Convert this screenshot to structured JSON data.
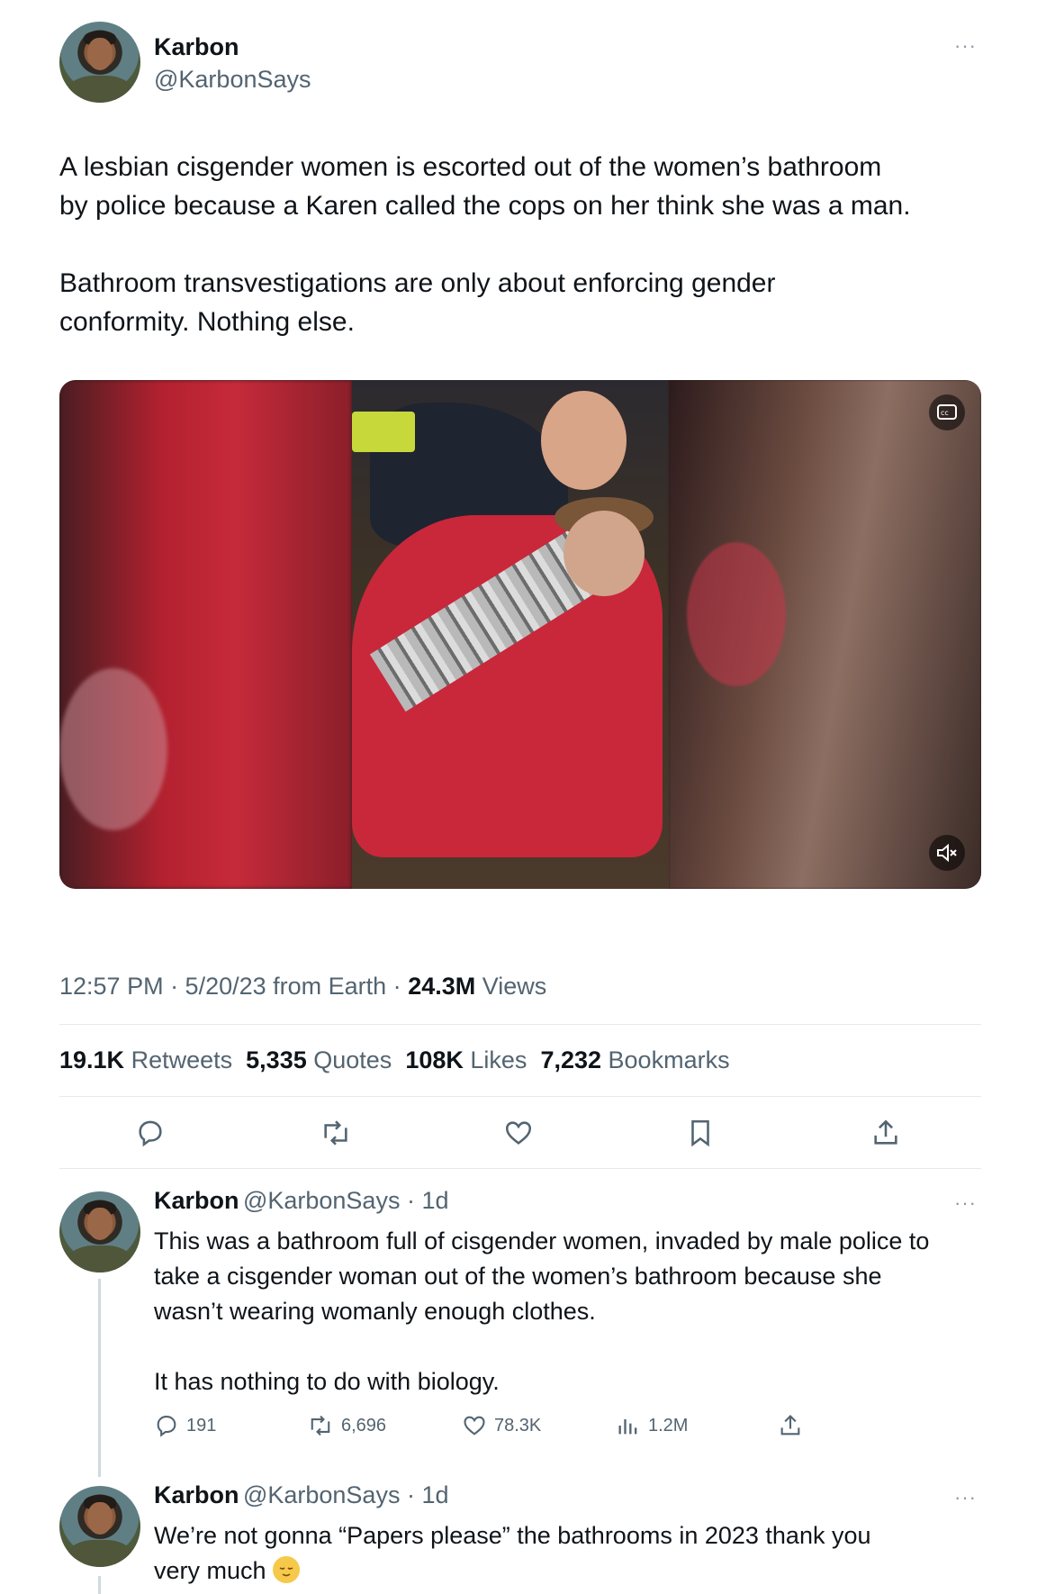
{
  "tweet": {
    "author_name": "Karbon",
    "author_handle": "@KarbonSays",
    "more": "···",
    "text_p1_line1": "A lesbian cisgender women is escorted out of the women’s bathroom",
    "text_p1_line2": "by police because a Karen called the cops on her think she was a man.",
    "text_p2_line1": "Bathroom transvestigations are only about enforcing gender",
    "text_p2_line2": "conformity. Nothing else.",
    "time": "12:57 PM · 5/20/23 from Earth · ",
    "views_count": "24.3M",
    "views_label": " Views",
    "stats": {
      "retweets_count": "19.1K",
      "retweets_label": "Retweets",
      "quotes_count": "5,335",
      "quotes_label": "Quotes",
      "likes_count": "108K",
      "likes_label": "Likes",
      "bookmarks_count": "7,232",
      "bookmarks_label": "Bookmarks"
    }
  },
  "replies": [
    {
      "author_name": "Karbon",
      "author_handle": "@KarbonSays",
      "time": " · 1d",
      "more": "···",
      "line1": "This was a bathroom full of cisgender women, invaded by male police to",
      "line2": "take a cisgender woman out of the women’s bathroom because she",
      "line3": "wasn’t wearing womanly enough clothes.",
      "line4": "It has nothing to do with biology.",
      "reply_count": "191",
      "retweet_count": "6,696",
      "like_count": "78.3K",
      "views_count": "1.2M"
    },
    {
      "author_name": "Karbon",
      "author_handle": "@KarbonSays",
      "time": " · 1d",
      "more": "···",
      "line1": "We’re not gonna “Papers please” the bathrooms in 2023 thank you",
      "line2": "very much"
    }
  ],
  "icons": {
    "avatar": "avatar",
    "reply": "reply-icon",
    "retweet": "retweet-icon",
    "like": "heart-icon",
    "bookmark": "bookmark-icon",
    "share": "share-icon",
    "views": "views-icon",
    "captions": "captions-icon",
    "mute": "mute-icon",
    "emoji": "relieved-face-emoji"
  },
  "colors": {
    "text": "#0f1419",
    "secondary": "#536471",
    "divider": "#e6e9ec"
  }
}
